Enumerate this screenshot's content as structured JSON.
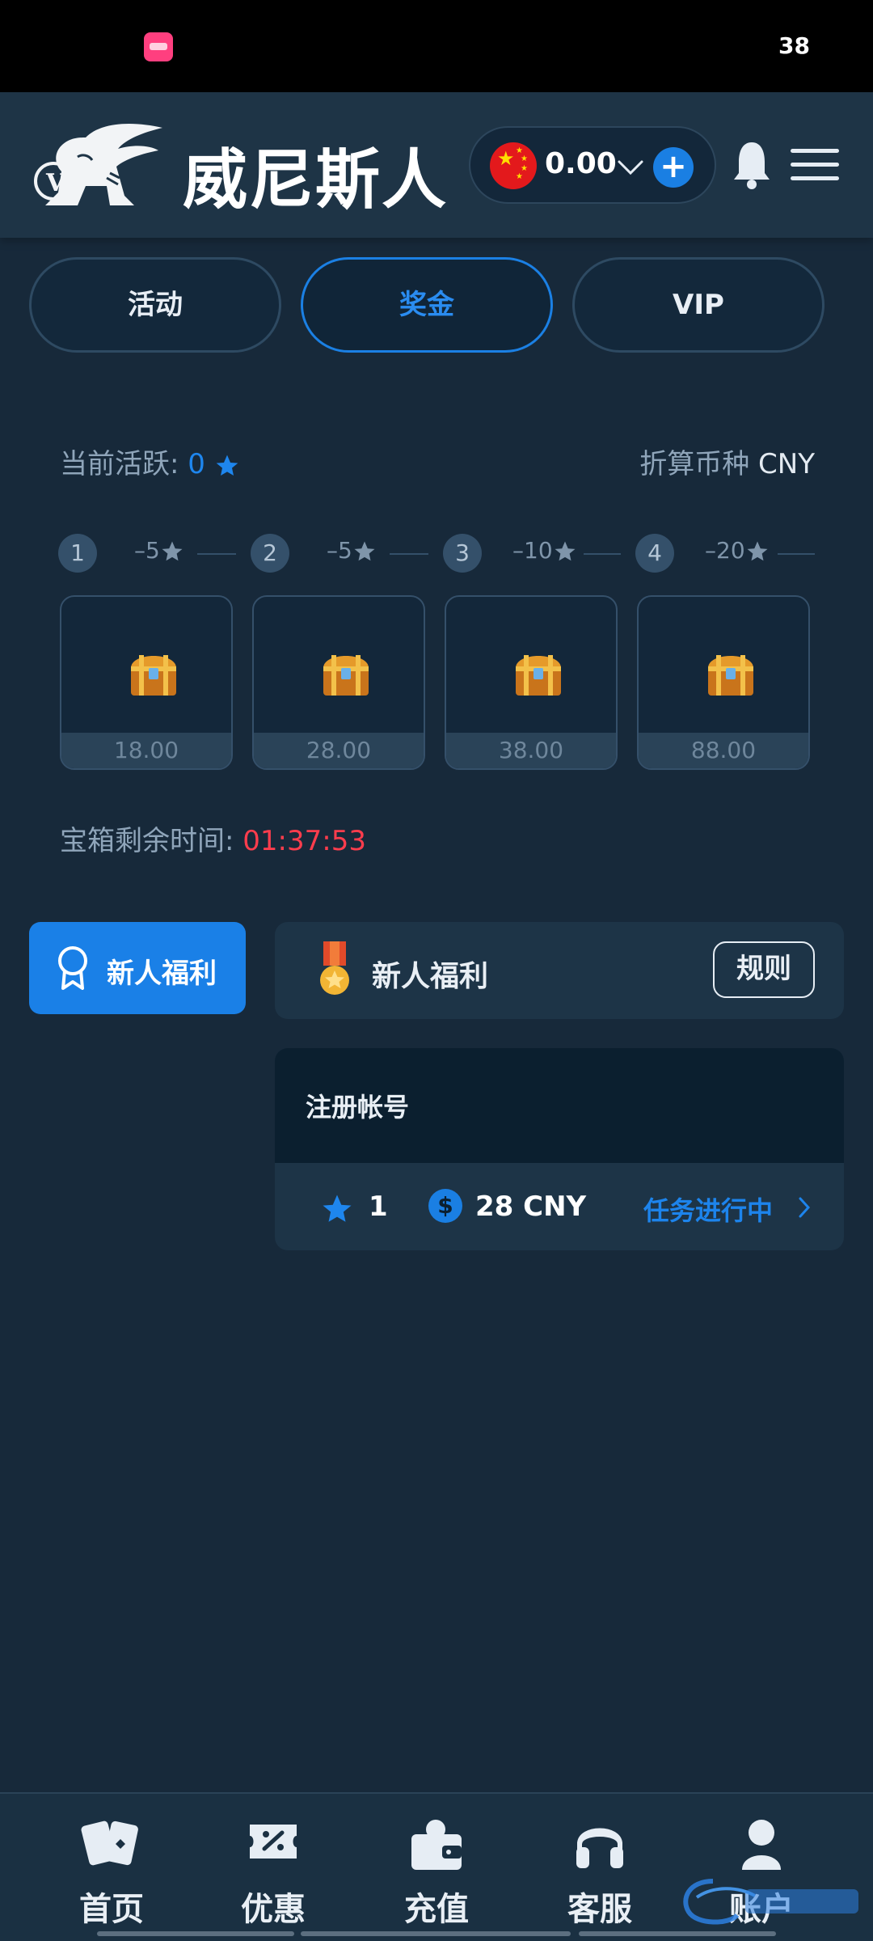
{
  "status_bar": {
    "right_text": "38"
  },
  "header": {
    "logo_text": "威尼斯人",
    "balance": "0.00",
    "icons": [
      "venetian-lion-logo",
      "china-flag-icon",
      "chevron-down-icon",
      "plus-icon",
      "bell-icon",
      "hamburger-menu-icon"
    ]
  },
  "tabs": [
    {
      "label": "活动",
      "active": false
    },
    {
      "label": "奖金",
      "active": true
    },
    {
      "label": "VIP",
      "active": false
    }
  ],
  "activity": {
    "label": "当前活跃:",
    "value": "0",
    "currency_label": "折算币种",
    "currency": "CNY"
  },
  "steps": [
    {
      "num": "1",
      "cost": "–5"
    },
    {
      "num": "2",
      "cost": "–5"
    },
    {
      "num": "3",
      "cost": "–10"
    },
    {
      "num": "4",
      "cost": "–20"
    }
  ],
  "chests": [
    {
      "amount": "18.00"
    },
    {
      "amount": "28.00"
    },
    {
      "amount": "38.00"
    },
    {
      "amount": "88.00"
    }
  ],
  "timer": {
    "label": "宝箱剩余时间:",
    "value": "01:37:53"
  },
  "sidebar": {
    "welfare_label": "新人福利"
  },
  "welfare": {
    "title": "新人福利",
    "rules_label": "规则"
  },
  "task": {
    "name": "注册帐号",
    "points": "1",
    "coin_symbol": "$",
    "reward": "28 CNY",
    "status": "任务进行中"
  },
  "bottom_nav": [
    {
      "label": "首页",
      "icon": "cards-icon"
    },
    {
      "label": "优惠",
      "icon": "coupon-icon"
    },
    {
      "label": "充值",
      "icon": "wallet-icon"
    },
    {
      "label": "客服",
      "icon": "headset-icon"
    },
    {
      "label": "账户",
      "icon": "user-icon"
    }
  ],
  "colors": {
    "accent": "#1a80e7",
    "timer": "#ff3d4d",
    "background": "#17293a"
  }
}
